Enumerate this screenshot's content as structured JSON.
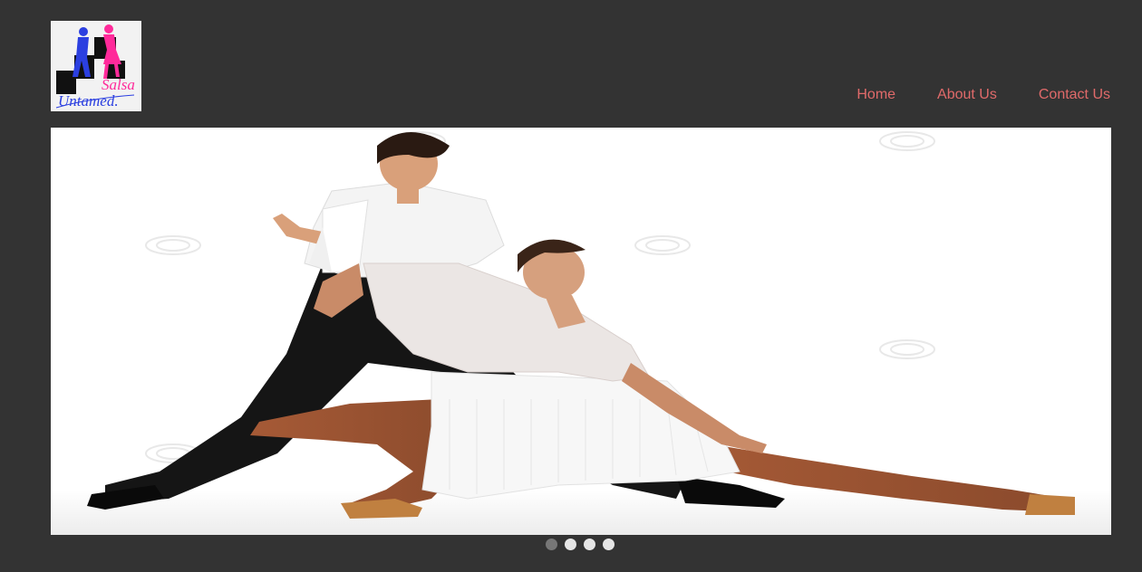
{
  "logo": {
    "text_line1": "Salsa",
    "text_line2": "Untamed."
  },
  "nav": {
    "items": [
      {
        "label": "Home"
      },
      {
        "label": "About Us"
      },
      {
        "label": "Contact Us"
      }
    ]
  },
  "slider": {
    "image_subject": "salsa-dancers-photo",
    "slide_count": 4,
    "active_slide": 1
  },
  "colors": {
    "background": "#333333",
    "nav_link": "#e06a6a",
    "dot_active": "#777777",
    "dot_inactive": "#e6e6e6"
  }
}
